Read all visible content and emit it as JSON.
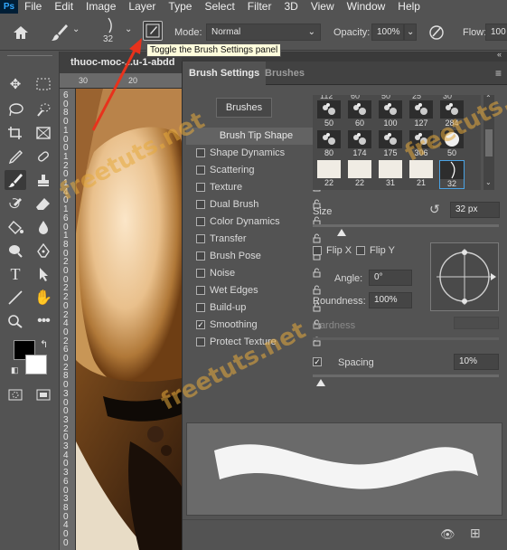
{
  "menu": {
    "logo": "Ps",
    "items": [
      "File",
      "Edit",
      "Image",
      "Layer",
      "Type",
      "Select",
      "Filter",
      "3D",
      "View",
      "Window",
      "Help"
    ]
  },
  "options": {
    "brush_size": "32",
    "mode_label": "Mode:",
    "mode_value": "Normal",
    "opacity_label": "Opacity:",
    "opacity_value": "100%",
    "flow_label": "Flow:",
    "flow_value": "100",
    "tooltip": "Toggle the Brush Settings panel"
  },
  "document": {
    "tab_title": "thuoc-moc-...u-1-abdd",
    "ruler_h": [
      "30",
      "20"
    ],
    "ruler_v": [
      "6",
      "0",
      "8",
      "0",
      "1",
      "0",
      "0",
      "1",
      "2",
      "0",
      "1",
      "4",
      "0",
      "1",
      "6",
      "0",
      "1",
      "8",
      "0",
      "2",
      "0",
      "0",
      "2",
      "2",
      "0",
      "2",
      "4",
      "0",
      "2",
      "6",
      "0",
      "2",
      "8",
      "0",
      "3",
      "0",
      "0",
      "3",
      "2",
      "0",
      "3",
      "4",
      "0",
      "3",
      "6",
      "0",
      "3",
      "8",
      "0",
      "4",
      "0",
      "0"
    ]
  },
  "panel": {
    "tab_active": "Brush Settings",
    "tab_inactive": "Brushes",
    "brushes_button": "Brushes",
    "options": [
      {
        "label": "Brush Tip Shape",
        "header": true
      },
      {
        "label": "Shape Dynamics",
        "checked": false
      },
      {
        "label": "Scattering",
        "checked": false
      },
      {
        "label": "Texture",
        "checked": false
      },
      {
        "label": "Dual Brush",
        "checked": false
      },
      {
        "label": "Color Dynamics",
        "checked": false
      },
      {
        "label": "Transfer",
        "checked": false
      },
      {
        "label": "Brush Pose",
        "checked": false
      },
      {
        "label": "Noise",
        "checked": false
      },
      {
        "label": "Wet Edges",
        "checked": false
      },
      {
        "label": "Build-up",
        "checked": false
      },
      {
        "label": "Smoothing",
        "checked": true
      },
      {
        "label": "Protect Texture",
        "checked": false
      }
    ],
    "presets_top_row": [
      "112",
      "60",
      "50",
      "25",
      "30"
    ],
    "presets": [
      {
        "size": "50"
      },
      {
        "size": "60"
      },
      {
        "size": "100"
      },
      {
        "size": "127"
      },
      {
        "size": "284"
      },
      {
        "size": "80"
      },
      {
        "size": "174"
      },
      {
        "size": "175"
      },
      {
        "size": "306"
      },
      {
        "size": "50"
      },
      {
        "size": "22"
      },
      {
        "size": "22"
      },
      {
        "size": "31"
      },
      {
        "size": "21"
      },
      {
        "size": "32",
        "selected": true
      }
    ],
    "size_label": "Size",
    "size_value": "32 px",
    "flip_x": "Flip X",
    "flip_y": "Flip Y",
    "angle_label": "Angle:",
    "angle_value": "0°",
    "roundness_label": "Roundness:",
    "roundness_value": "100%",
    "hardness_label": "Hardness",
    "spacing_label": "Spacing",
    "spacing_value": "10%",
    "spacing_checked": true
  },
  "watermarks": [
    "freetuts.net",
    "freetuts.net",
    "freetuts.net"
  ]
}
